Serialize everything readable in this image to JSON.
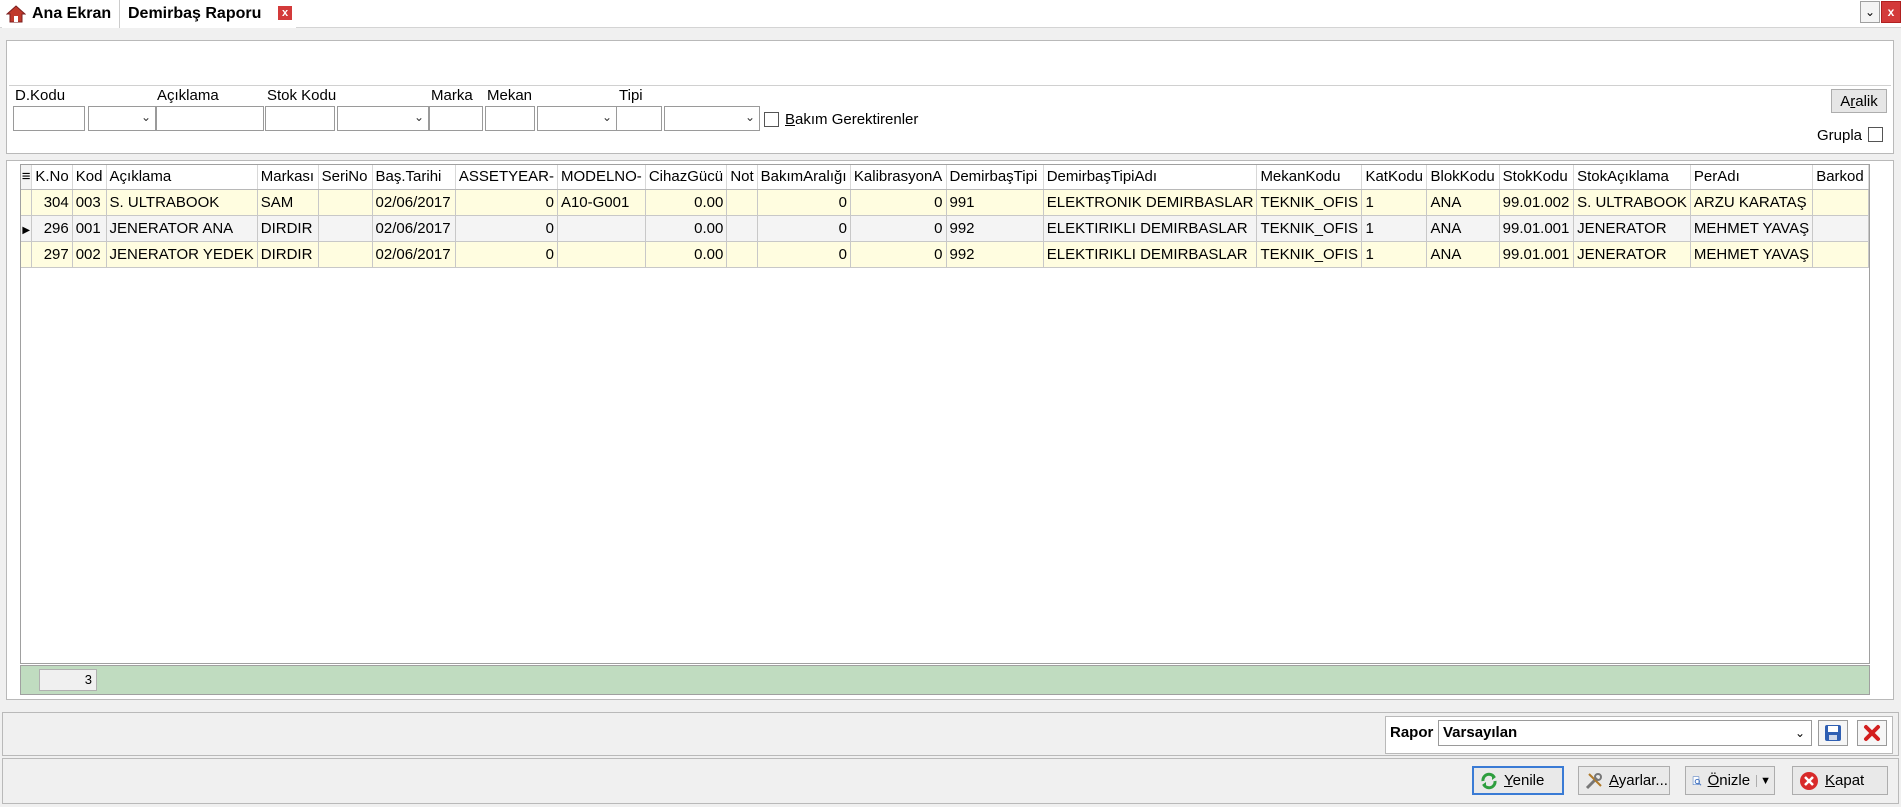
{
  "tabs": {
    "home_label": "Ana Ekran",
    "active_label": "Demirbaş Raporu",
    "close_glyph": "x"
  },
  "filters": {
    "dkodu_label": "D.Kodu",
    "aciklama_label": "Açıklama",
    "stok_kodu_label": "Stok Kodu",
    "marka_label": "Marka",
    "mekan_label": "Mekan",
    "tipi_label": "Tipi",
    "bakim_label_first": "B",
    "bakim_label_rest": "akım Gerektirenler",
    "aralik_first": "A",
    "aralik_underlined": "r",
    "aralik_rest": "alik",
    "grupla_label": "Grupla"
  },
  "grid": {
    "columns": [
      "K.No",
      "Kod",
      "Açıklama",
      "Markası",
      "SeriNo",
      "Baş.Tarihi",
      "ASSETYEAR-",
      "MODELNO-",
      "CihazGücü",
      "Not",
      "BakımAralığı",
      "KalibrasyonA",
      "DemirbaşTipi",
      "DemirbaşTipiAdı",
      "MekanKodu",
      "KatKodu",
      "BlokKodu",
      "StokKodu",
      "StokAçıklama",
      "PerAdı",
      "Barkod"
    ],
    "rows": [
      [
        "304",
        "003",
        "S. ULTRABOOK",
        "SAM",
        "",
        "02/06/2017",
        "0",
        "A10-G001",
        "0.00",
        "",
        "0",
        "0",
        "991",
        "ELEKTRONIK DEMIRBASLAR",
        "TEKNIK_OFIS",
        "1",
        "ANA",
        "99.01.002",
        "S. ULTRABOOK",
        "ARZU KARATAŞ",
        ""
      ],
      [
        "296",
        "001",
        "JENERATOR ANA",
        "DIRDIR",
        "",
        "02/06/2017",
        "0",
        "",
        "0.00",
        "",
        "0",
        "0",
        "992",
        "ELEKTIRIKLI DEMIRBASLAR",
        "TEKNIK_OFIS",
        "1",
        "ANA",
        "99.01.001",
        "JENERATOR",
        "MEHMET YAVAŞ",
        ""
      ],
      [
        "297",
        "002",
        "JENERATOR YEDEK",
        "DIRDIR",
        "",
        "02/06/2017",
        "0",
        "",
        "0.00",
        "",
        "0",
        "0",
        "992",
        "ELEKTIRIKLI DEMIRBASLAR",
        "TEKNIK_OFIS",
        "1",
        "ANA",
        "99.01.001",
        "JENERATOR",
        "MEHMET YAVAŞ",
        ""
      ]
    ],
    "selected_row_index": 1,
    "footer_count": "3"
  },
  "rapor": {
    "label": "Rapor",
    "selected": "Varsayılan"
  },
  "actions": {
    "yenile_first": "Y",
    "yenile_rest": "enile",
    "ayarlar_first": "A",
    "ayarlar_rest": "yarlar...",
    "onizle_first": "Ö",
    "onizle_rest": "nizle",
    "kapat_first": "K",
    "kapat_rest": "apat"
  },
  "colors": {
    "odd_row": "#fffde0",
    "footer_green": "#c0dcc0",
    "close_red": "#d33a3a",
    "focus_blue": "#3a7bd5"
  }
}
